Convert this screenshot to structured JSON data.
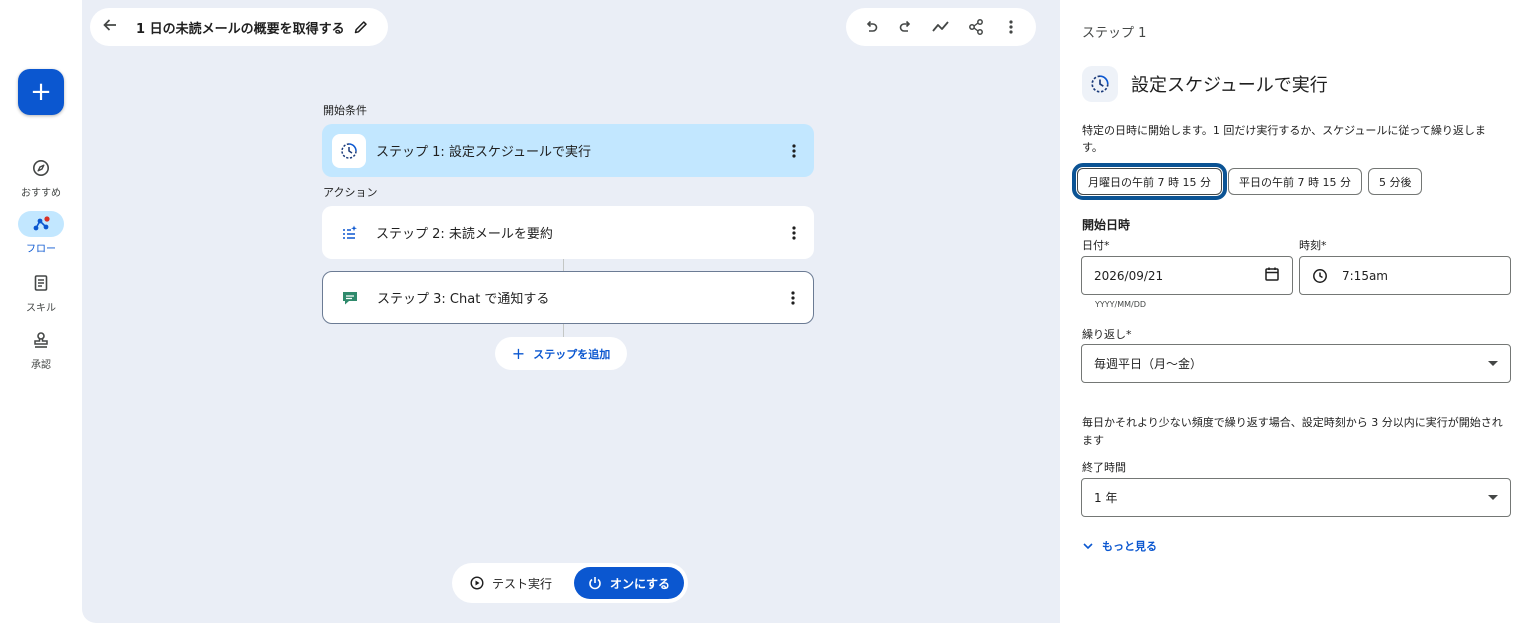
{
  "rail": {
    "fab_label": "+",
    "items": [
      {
        "label": "おすすめ",
        "icon": "compass-icon"
      },
      {
        "label": "フロー",
        "icon": "flow-icon",
        "active": true
      },
      {
        "label": "スキル",
        "icon": "skill-icon"
      },
      {
        "label": "承認",
        "icon": "approval-icon"
      }
    ]
  },
  "header": {
    "title": "1 日の未読メールの概要を取得する"
  },
  "canvas": {
    "trigger_label": "開始条件",
    "action_label": "アクション",
    "steps": [
      {
        "label": "ステップ 1: 設定スケジュールで実行",
        "icon": "schedule-icon"
      },
      {
        "label": "ステップ 2: 未読メールを要約",
        "icon": "summarize-icon"
      },
      {
        "label": "ステップ 3: Chat で通知する",
        "icon": "chat-icon"
      }
    ],
    "add_step_label": "ステップを追加",
    "test_run_label": "テスト実行",
    "turn_on_label": "オンにする"
  },
  "panel": {
    "step_caption": "ステップ 1",
    "title": "設定スケジュールで実行",
    "description": "特定の日時に開始します。1 回だけ実行するか、スケジュールに従って繰り返します。",
    "chips": [
      "月曜日の午前 7 時 15 分",
      "平日の午前 7 時 15 分",
      "5 分後"
    ],
    "start_heading": "開始日時",
    "date_label": "日付*",
    "date_value": "2026/09/21",
    "date_helper": "YYYY/MM/DD",
    "time_label": "時刻*",
    "time_value": "7:15am",
    "repeat_label": "繰り返し*",
    "repeat_value": "毎週平日（月〜金）",
    "repeat_note": "毎日かそれより少ない頻度で繰り返す場合、設定時刻から 3 分以内に実行が開始されます",
    "end_heading": "終了時間",
    "end_value": "1 年",
    "more_label": "もっと見る"
  },
  "colors": {
    "accent": "#0b57d0",
    "selected_step": "#c2e7ff",
    "canvas_bg": "#eaeef6",
    "focus_ring": "#0b5394"
  }
}
